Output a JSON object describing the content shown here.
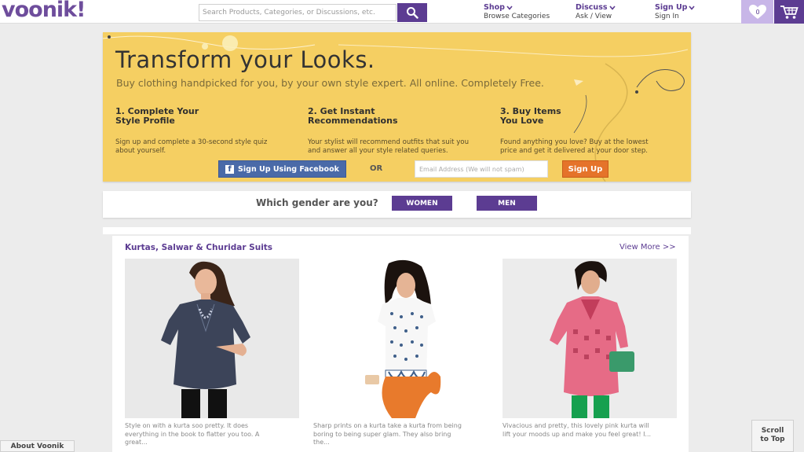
{
  "header": {
    "logo": "voonik!",
    "search": {
      "placeholder": "Search Products, Categories, or Discussions, etc."
    },
    "nav": {
      "shop": {
        "label": "Shop",
        "sub": "Browse Categories"
      },
      "discuss": {
        "label": "Discuss",
        "sub": "Ask / View"
      },
      "signup": {
        "label": "Sign Up",
        "sub": "Sign In"
      }
    },
    "wishlist_count": "0"
  },
  "hero": {
    "title": "Transform your Looks.",
    "subtitle": "Buy clothing handpicked for you, by your own style expert. All online. Completely Free.",
    "steps": [
      {
        "title": "1. Complete Your\nStyle Profile",
        "desc": "Sign up and complete a 30-second style quiz\nabout yourself."
      },
      {
        "title": "2. Get Instant\nRecommendations",
        "desc": "Your stylist will recommend outfits that suit you\nand answer all your style related queries."
      },
      {
        "title": "3. Buy Items\nYou Love",
        "desc": "Found anything you love? Buy at the lowest\nprice and get it delivered at your door step."
      }
    ],
    "facebook_button": "Sign Up Using Facebook",
    "or_label": "OR",
    "email_placeholder": "Email Address (We will not spam)",
    "signup_button": "Sign Up"
  },
  "gender": {
    "question": "Which gender are you?",
    "women": "WOMEN",
    "men": "MEN"
  },
  "products": {
    "heading": "Kurtas, Salwar & Churidar Suits",
    "view_more": "View More >>",
    "items": [
      {
        "desc": "Style on with a kurta soo pretty. It does\neverything in the book to flatter you too. A\ngreat..."
      },
      {
        "desc": "Sharp prints on a kurta take a kurta from being\nboring to being super glam. They also bring\nthe..."
      },
      {
        "desc": "Vivacious and pretty, this lovely pink kurta will\nlift your moods up and make you feel great! I..."
      }
    ]
  },
  "footer": {
    "about": "About Voonik",
    "scroll_top": "Scroll\nto Top"
  },
  "colors": {
    "brand_purple": "#5c3c92",
    "hero_yellow": "#f5cf62",
    "signup_orange": "#e5732a",
    "facebook_blue": "#4a6aa8"
  },
  "icons": [
    "search-icon",
    "chevron-down-icon",
    "heart-icon",
    "cart-icon",
    "facebook-icon"
  ]
}
